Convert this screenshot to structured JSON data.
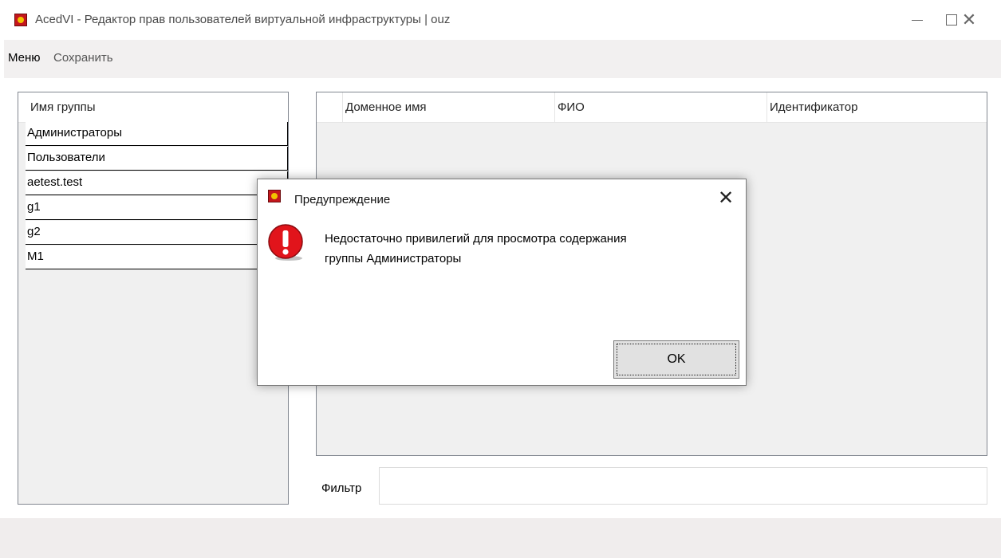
{
  "window": {
    "title": "AcedVI - Редактор прав пользователей виртуальной инфраструктуры | ouz",
    "minimize_glyph": "—",
    "close_glyph": "✕"
  },
  "menu": {
    "items": [
      "Меню",
      "Сохранить"
    ]
  },
  "groups": {
    "header": "Имя группы",
    "rows": [
      "Администраторы",
      "Пользователи",
      "aetest.test",
      "g1",
      "g2",
      "M1"
    ]
  },
  "users": {
    "columns": [
      "Доменное имя",
      "ФИО",
      "Идентификатор"
    ]
  },
  "filter": {
    "label": "Фильтр",
    "value": ""
  },
  "dialog": {
    "title": "Предупреждение",
    "message_line1": "Недостаточно привилегий для просмотра содержания",
    "message_line2": "группы Администраторы",
    "ok_label": "OK",
    "close_glyph": "✕",
    "icon": "error-exclamation-icon",
    "icon_color": "#e1141b"
  },
  "colors": {
    "menubar_bg": "#f2f0f0",
    "panel_bg": "#f0f0f0",
    "statusbar_bg": "#f0eded"
  }
}
